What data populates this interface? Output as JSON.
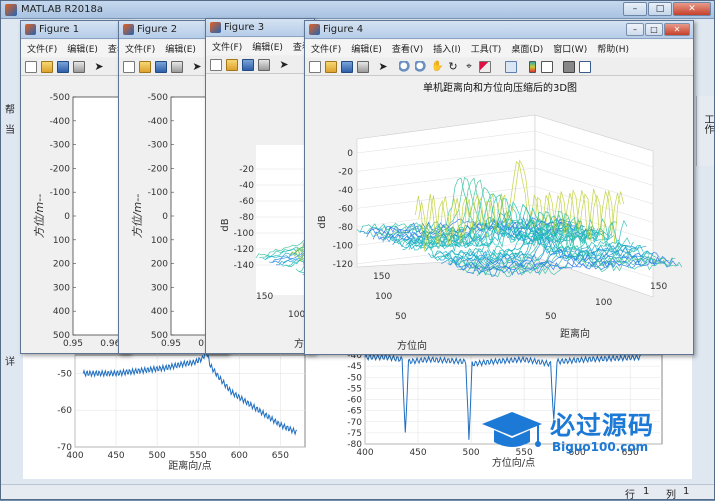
{
  "main": {
    "title": "MATLAB R2018a",
    "stub_a": "帮",
    "stub_b": "当",
    "stub_c": "详",
    "side_panel": "工作",
    "status_row": "行",
    "status_row_val": "1",
    "status_col": "列",
    "status_col_val": "1"
  },
  "figures": [
    {
      "title": "Figure 1",
      "menu": [
        "文件(F)",
        "编辑(E)",
        "查看"
      ],
      "xaxis_label": "",
      "yaxis_label": "方位/m--"
    },
    {
      "title": "Figure 2",
      "menu": [
        "文件(F)",
        "编辑(E)",
        "查看"
      ],
      "yaxis_label": "方位/m--"
    },
    {
      "title": "Figure 3",
      "menu": [
        "文件(F)",
        "编辑(E)",
        "查看"
      ],
      "zlabel": "dB",
      "ylabel": "方位"
    },
    {
      "title": "Figure 4",
      "menu": [
        "文件(F)",
        "编辑(E)",
        "查看(V)",
        "插入(I)",
        "工具(T)",
        "桌面(D)",
        "窗口(W)",
        "帮助(H)"
      ],
      "plot_title": "单机距离向和方位向压缩后的3D图",
      "zlabel": "dB",
      "xlabel": "距离向",
      "ylabel": "方位向"
    }
  ],
  "background_plots": {
    "left_xlabel": "距离向/点",
    "right_xlabel": "方位向/点"
  },
  "watermark": {
    "line1": "必过源码",
    "line2": "Biguo100.com"
  },
  "chart_data": [
    {
      "type": "line",
      "title": "Figure 1",
      "xlabel": "",
      "ylabel": "方位/m--",
      "xlim": [
        0.95,
        0.965
      ],
      "ylim": [
        -500,
        500
      ],
      "y_reversed": true,
      "x_ticks": [
        0.95,
        0.96
      ],
      "y_ticks": [
        -500,
        -400,
        -300,
        -200,
        -100,
        0,
        100,
        200,
        300,
        400,
        500
      ],
      "series": []
    },
    {
      "type": "line",
      "title": "Figure 2",
      "ylabel": "方位/m--",
      "xlim": [
        0.95,
        0.965
      ],
      "ylim": [
        -500,
        500
      ],
      "y_reversed": true,
      "x_ticks": [
        0.95,
        0.96
      ],
      "y_ticks": [
        -500,
        -400,
        -300,
        -200,
        -100,
        0,
        100,
        200,
        300,
        400,
        500
      ],
      "series": []
    },
    {
      "type": "surface",
      "title": "Figure 3",
      "zlabel": "dB",
      "ylabel": "方位",
      "z_ticks": [
        -20,
        -40,
        -60,
        -80,
        -100,
        -120,
        -140
      ],
      "y_ticks": [
        150,
        100
      ]
    },
    {
      "type": "surface",
      "title": "单机距离向和方位向压缩后的3D图",
      "zlabel": "dB",
      "xlabel": "距离向",
      "ylabel": "方位向",
      "zlim": [
        -130,
        0
      ],
      "z_ticks": [
        0,
        -20,
        -40,
        -60,
        -80,
        -100,
        -120
      ],
      "x_ticks": [
        50,
        100,
        150
      ],
      "y_ticks": [
        150,
        100,
        50
      ]
    },
    {
      "type": "line",
      "title": "",
      "xlabel": "距离向/点",
      "ylabel": "",
      "xlim": [
        400,
        680
      ],
      "ylim": [
        -70,
        -45
      ],
      "x_ticks": [
        400,
        450,
        500,
        550,
        600,
        650
      ],
      "y_ticks": [
        -50,
        -60,
        -70
      ],
      "x": [
        410,
        430,
        450,
        470,
        490,
        510,
        530,
        545,
        555,
        560,
        565,
        575,
        590,
        610,
        630,
        650,
        670
      ],
      "values": [
        -50,
        -50,
        -50,
        -49.5,
        -49,
        -48.5,
        -47.5,
        -47,
        -46,
        -44,
        -48,
        -51,
        -55,
        -58,
        -61,
        -64,
        -66
      ]
    },
    {
      "type": "line",
      "title": "",
      "xlabel": "方位向/点",
      "ylabel": "",
      "xlim": [
        400,
        680
      ],
      "ylim": [
        -80,
        -40
      ],
      "x_ticks": [
        400,
        450,
        500,
        550,
        600,
        650
      ],
      "y_ticks": [
        -40,
        -45,
        -50,
        -55,
        -60,
        -65,
        -70,
        -75,
        -80
      ],
      "x": [
        400,
        420,
        435,
        438,
        441,
        460,
        495,
        498,
        501,
        520,
        550,
        575,
        578,
        581,
        610,
        660
      ],
      "values": [
        -41,
        -41,
        -42,
        -76,
        -43,
        -42,
        -43,
        -78,
        -44,
        -43,
        -42,
        -44,
        -70,
        -43,
        -42,
        -41
      ]
    }
  ]
}
